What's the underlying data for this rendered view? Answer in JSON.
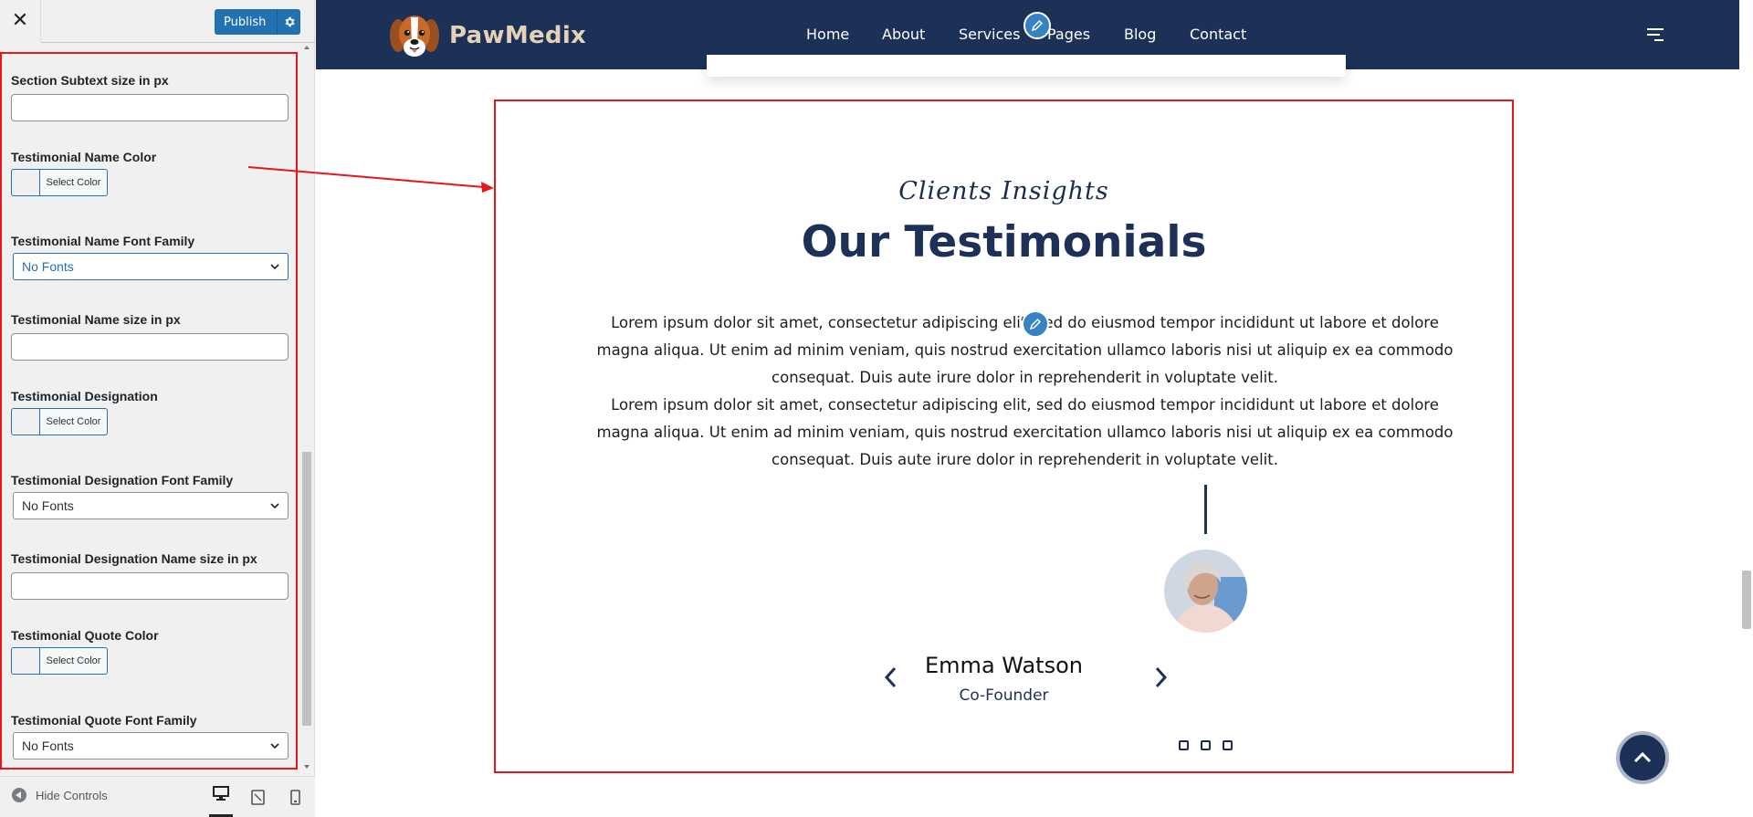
{
  "toolbar": {
    "close_glyph": "✕",
    "publish_label": "Publish"
  },
  "controls": [
    {
      "label": "Section Subtext size in px",
      "type": "text",
      "value": ""
    },
    {
      "label": "Testimonial Name Color",
      "type": "color",
      "button_text": "Select Color"
    },
    {
      "label": "Testimonial Name Font Family",
      "type": "select",
      "selected": "No Fonts"
    },
    {
      "label": "Testimonial Name size in px",
      "type": "text",
      "value": ""
    },
    {
      "label": "Testimonial Designation",
      "type": "color",
      "button_text": "Select Color"
    },
    {
      "label": "Testimonial Designation Font Family",
      "type": "select",
      "selected": "No Fonts"
    },
    {
      "label": "Testimonial Designation Name size in px",
      "type": "text",
      "value": ""
    },
    {
      "label": "Testimonial Quote Color",
      "type": "color",
      "button_text": "Select Color"
    },
    {
      "label": "Testimonial Quote Font Family",
      "type": "select",
      "selected": "No Fonts"
    }
  ],
  "footer": {
    "hide_controls_label": "Hide Controls"
  },
  "site": {
    "brand": "PawMedix",
    "nav": [
      "Home",
      "About",
      "Services",
      "Pages",
      "Blog",
      "Contact"
    ]
  },
  "testimonials": {
    "subtitle": "Clients Insights",
    "title": "Our Testimonials",
    "quote_paragraphs": [
      "Lorem ipsum dolor sit amet, consectetur adipiscing elit, sed do eiusmod tempor incididunt ut labore et dolore magna aliqua. Ut enim ad minim veniam, quis nostrud exercitation ullamco laboris nisi ut aliquip ex ea commodo consequat. Duis aute irure dolor in reprehenderit in voluptate velit.",
      "Lorem ipsum dolor sit amet, consectetur adipiscing elit, sed do eiusmod tempor incididunt ut labore et dolore magna aliqua. Ut enim ad minim veniam, quis nostrud exercitation ullamco laboris nisi ut aliquip ex ea commodo consequat. Duis aute irure dolor in reprehenderit in voluptate velit."
    ],
    "person_name": "Emma Watson",
    "person_role": "Co-Founder",
    "slide_count": 3
  },
  "icons": {
    "close": "close-icon",
    "publish_settings": "gear-icon",
    "hide_controls": "collapse-arrow-icon",
    "devices": [
      "desktop-icon",
      "tablet-icon",
      "mobile-icon"
    ],
    "menu": "hamburger-menu-icon",
    "edit": "pencil-icon",
    "prev": "chevron-left-icon",
    "next": "chevron-right-icon",
    "scroll_top": "chevron-up-icon"
  },
  "colors": {
    "header_bg": "#1c3058",
    "brand_text": "#e3d2b5",
    "publish_blue": "#2271b1",
    "highlight_red": "#e8151b",
    "edit_blue": "#3582c4"
  }
}
